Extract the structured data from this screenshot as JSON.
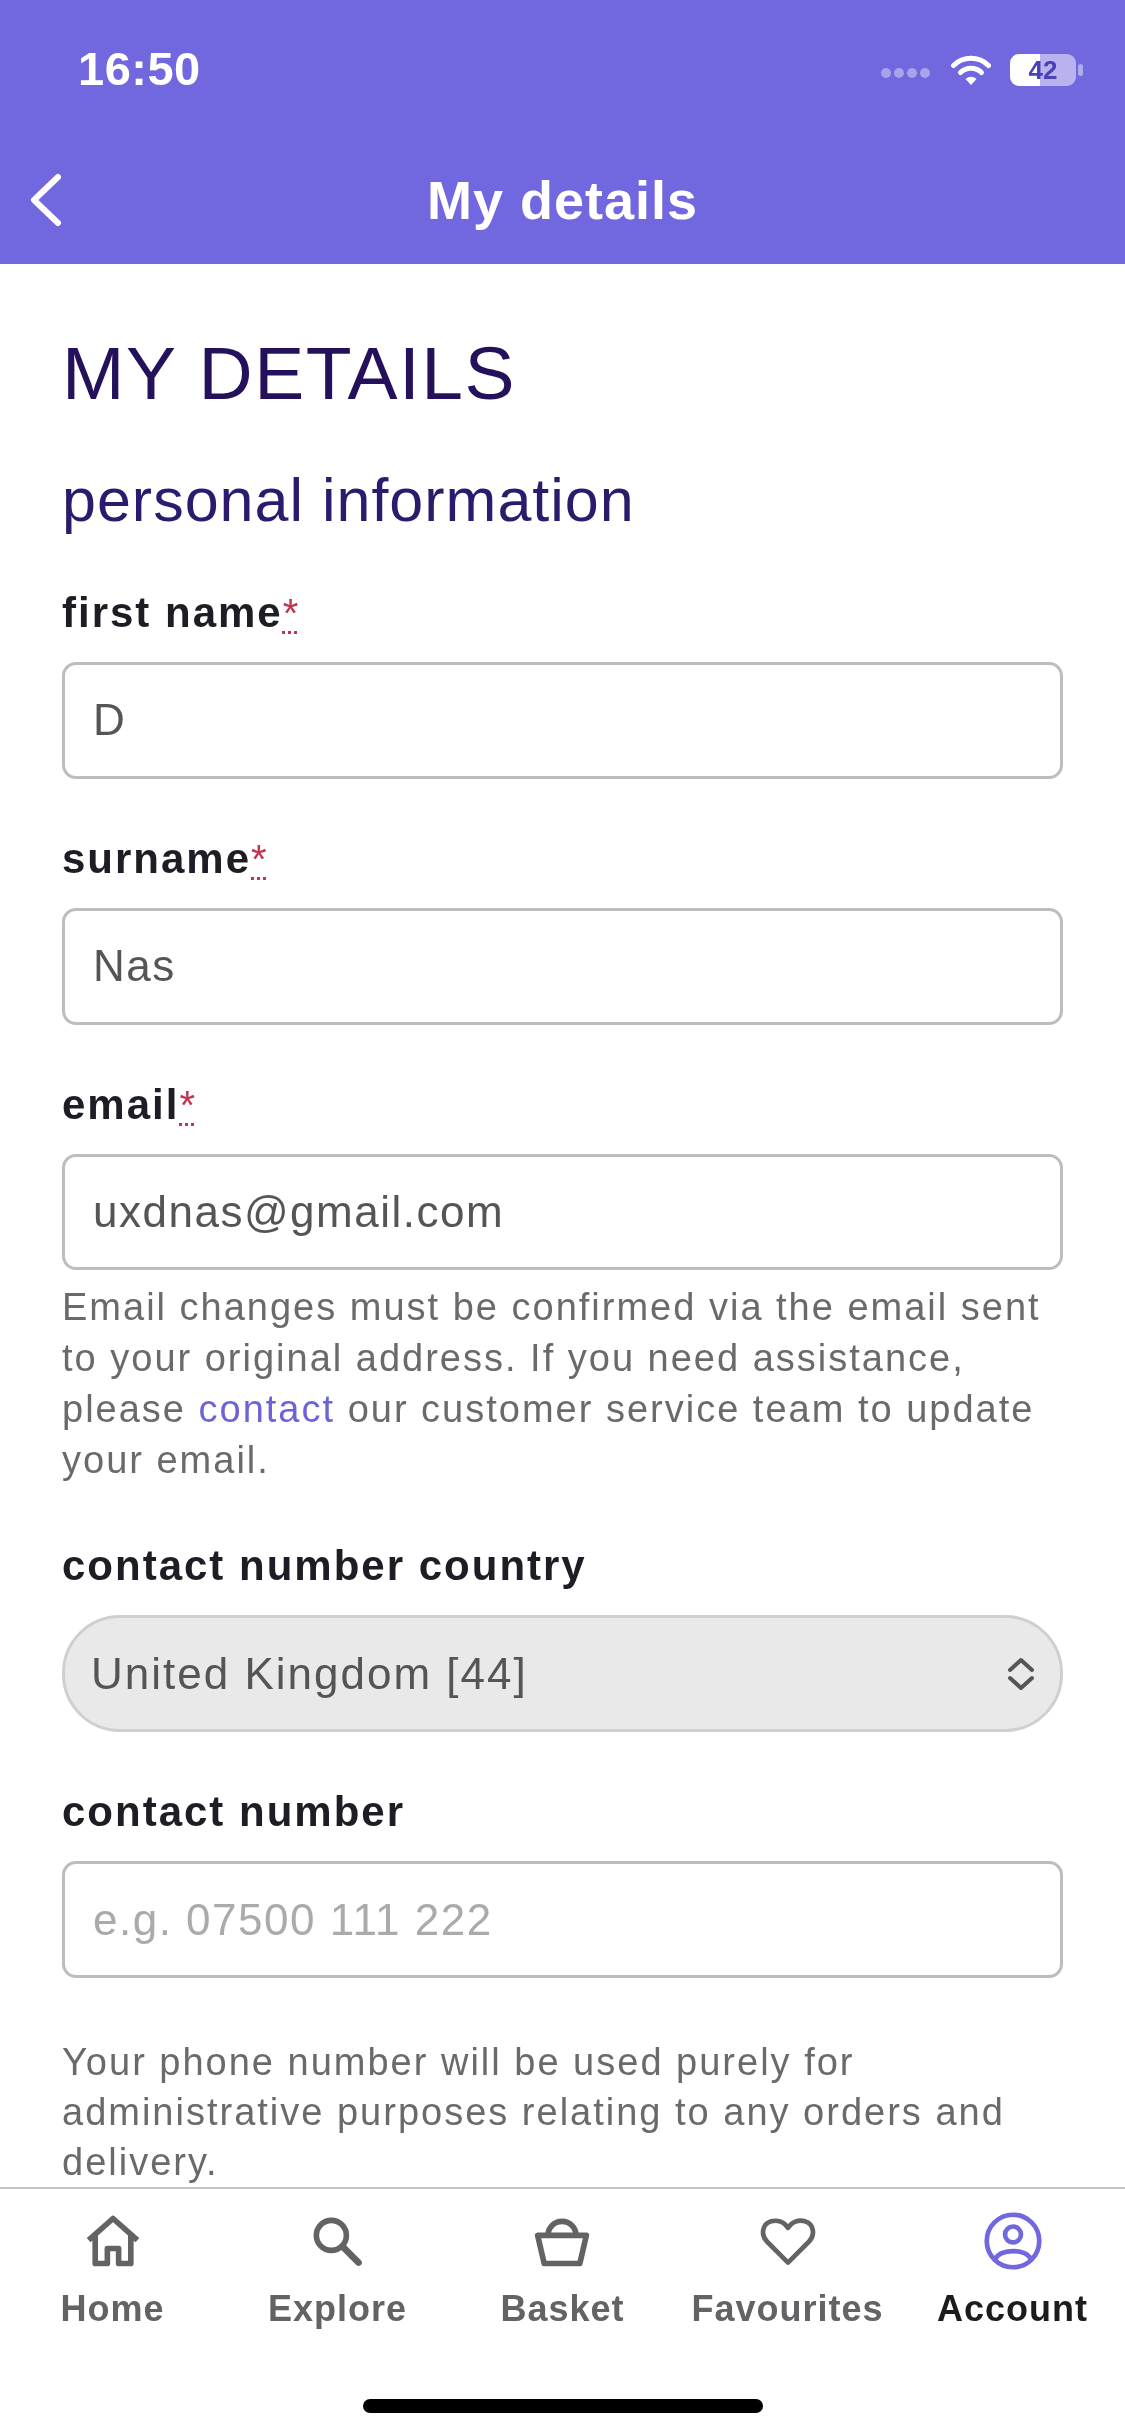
{
  "status_bar": {
    "time": "16:50",
    "battery": "42"
  },
  "nav_bar": {
    "title": "My details"
  },
  "page": {
    "heading": "MY DETAILS",
    "section_title": "personal information"
  },
  "fields": [
    {
      "kind": "text",
      "label": "first name",
      "required_mark": "*",
      "value": "D"
    },
    {
      "kind": "text",
      "label": "surname",
      "required_mark": "*",
      "value": "Nas"
    },
    {
      "kind": "text",
      "label": "email",
      "required_mark": "*",
      "value": "uxdnas@gmail.com",
      "note": {
        "text_before": "Email changes must be confirmed via the email sent to your original address. If you need assistance, please",
        "link": "contact",
        "text_after": "our customer service team to update your email."
      }
    },
    {
      "kind": "select",
      "label": "contact number country",
      "value": "United Kingdom [44]"
    },
    {
      "kind": "text",
      "label": "contact number",
      "placeholder": "e.g. 07500 111 222",
      "note": {
        "text_before": "Your phone number will be used purely for administrative purposes relating to any orders and delivery."
      }
    }
  ],
  "tab_bar": [
    {
      "label": "Home",
      "selected": false
    },
    {
      "label": "Explore",
      "selected": false
    },
    {
      "label": "Basket",
      "selected": false
    },
    {
      "label": "Favourites",
      "selected": false
    },
    {
      "label": "Account",
      "selected": true
    }
  ]
}
